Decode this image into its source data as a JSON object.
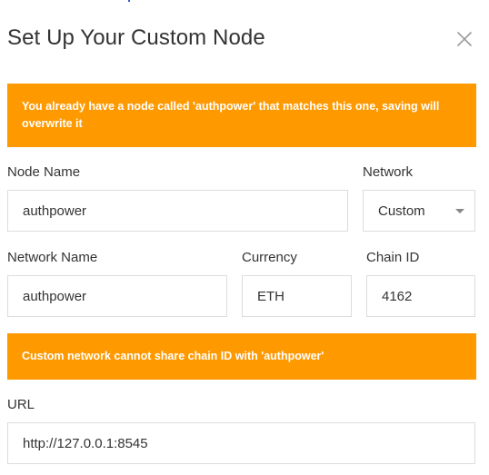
{
  "dialog": {
    "title": "Set Up Your Custom Node",
    "close_icon": "close-icon"
  },
  "warnings": {
    "duplicate_node": "You already have a node called 'authpower' that matches this one, saving will overwrite it",
    "chain_id_conflict": "Custom network cannot share chain ID with 'authpower'"
  },
  "form": {
    "node_name": {
      "label": "Node Name",
      "value": "authpower"
    },
    "network": {
      "label": "Network",
      "value": "Custom"
    },
    "network_name": {
      "label": "Network Name",
      "value": "authpower"
    },
    "currency": {
      "label": "Currency",
      "value": "ETH"
    },
    "chain_id": {
      "label": "Chain ID",
      "value": "4162"
    },
    "url": {
      "label": "URL",
      "value": "http://127.0.0.1:8545"
    }
  },
  "colors": {
    "warning_bg": "#ff9900",
    "warning_text": "#ffffff",
    "text": "#333333",
    "border": "#dcdcdc"
  }
}
